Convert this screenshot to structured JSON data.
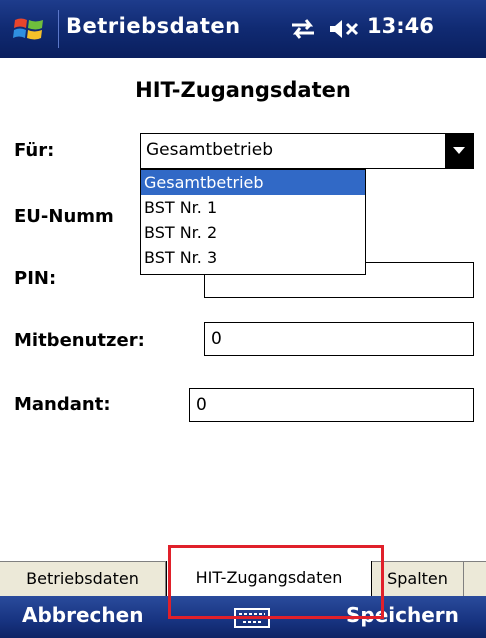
{
  "title_bar": {
    "app_title": "Betriebsdaten",
    "time": "13:46"
  },
  "page": {
    "heading": "HIT-Zugangsdaten"
  },
  "form": {
    "fuer_label": "Für:",
    "fuer_selected": "Gesamtbetrieb",
    "dropdown_options": [
      "Gesamtbetrieb",
      "BST Nr. 1",
      "BST Nr. 2",
      "BST Nr. 3"
    ],
    "eu_label": "EU-Numm",
    "pin_label": "PIN:",
    "mitbenutzer_label": "Mitbenutzer:",
    "mitbenutzer_value": "0",
    "mandant_label": "Mandant:",
    "mandant_value": "0"
  },
  "tabs": [
    {
      "label": "Betriebsdaten",
      "active": false
    },
    {
      "label": "HIT-Zugangsdaten",
      "active": true
    },
    {
      "label": "Spalten",
      "active": false
    }
  ],
  "softkeys": {
    "left": "Abbrechen",
    "right": "Speichern"
  },
  "colors": {
    "selection": "#3169c6",
    "highlight_box": "#e0202a",
    "bar_blue": "#173380"
  },
  "icons": {
    "start": "windows-flag-icon",
    "connectivity": "sync-arrows-icon",
    "volume": "speaker-muted-icon",
    "keyboard": "keyboard-icon"
  }
}
